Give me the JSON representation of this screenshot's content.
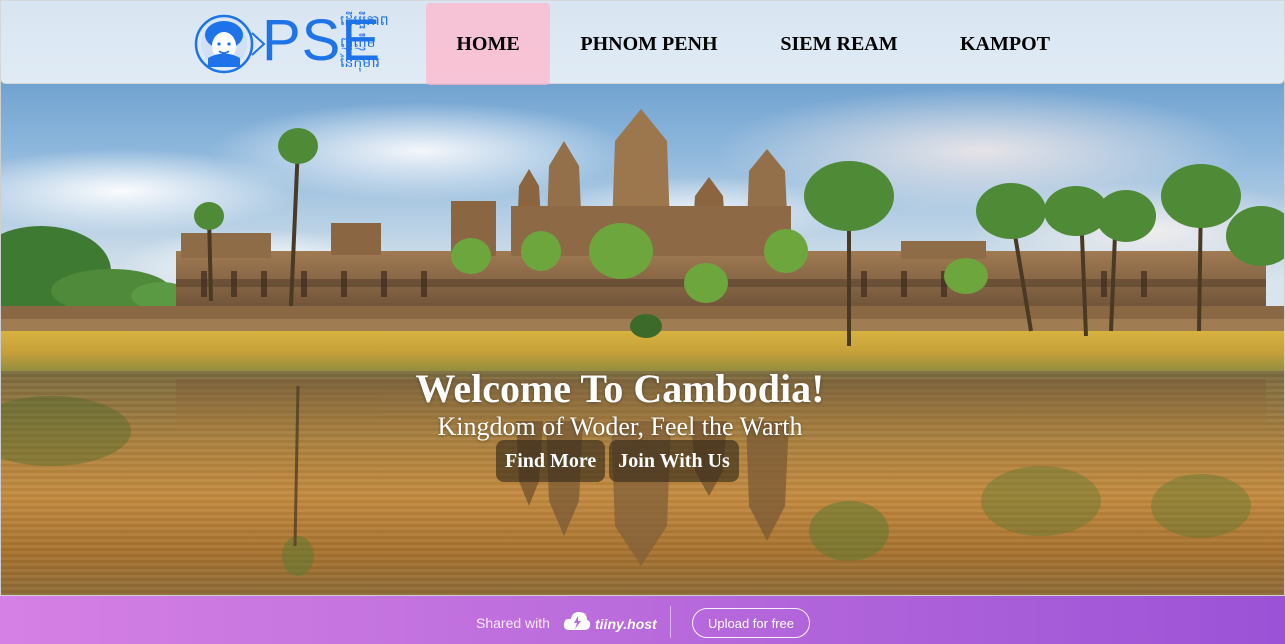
{
  "logo": {
    "text": "PSE",
    "khmer_line1": "ដើម្បីភាព",
    "khmer_line2": "ញញឹម",
    "khmer_line3": "នៃកុមារ",
    "color": "#1e73e8"
  },
  "nav": {
    "items": [
      {
        "label": "HOME",
        "active": true
      },
      {
        "label": "PHNOM PENH",
        "active": false
      },
      {
        "label": "SIEM REAM",
        "active": false
      },
      {
        "label": "KAMPOT",
        "active": false
      }
    ],
    "active_color": "#ffb6cb"
  },
  "hero": {
    "title": "Welcome To Cambodia!",
    "subtitle": "Kingdom of Woder, Feel the Warth",
    "buttons": [
      {
        "label": "Find More"
      },
      {
        "label": "Join With Us"
      }
    ]
  },
  "banner": {
    "shared_text": "Shared with",
    "brand": "tiiny.host",
    "upload_label": "Upload for free"
  }
}
